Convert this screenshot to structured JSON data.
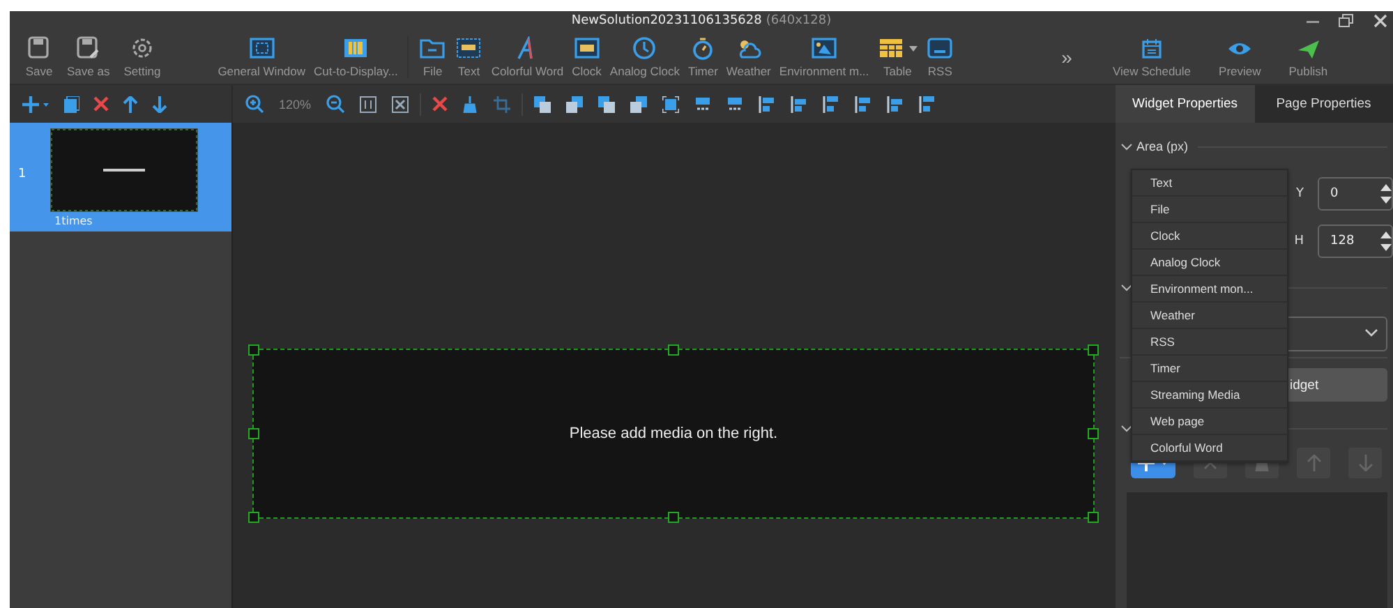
{
  "window": {
    "title": "NewSolution20231106135628",
    "resolution": "(640x128)"
  },
  "toolbar_groups": [
    {
      "items": [
        {
          "label": "Save",
          "has_menu": false
        },
        {
          "label": "Save as",
          "has_menu": false
        },
        {
          "label": "Setting",
          "has_menu": false
        }
      ]
    },
    {
      "items": [
        {
          "label": "General Window",
          "has_menu": false
        },
        {
          "label": "Cut-to-Display...",
          "has_menu": false
        }
      ]
    },
    {
      "items": [
        {
          "label": "File",
          "has_menu": false
        },
        {
          "label": "Text",
          "has_menu": false
        },
        {
          "label": "Colorful Word",
          "has_menu": false
        },
        {
          "label": "Clock",
          "has_menu": false
        },
        {
          "label": "Analog Clock",
          "has_menu": false
        },
        {
          "label": "Timer",
          "has_menu": false
        },
        {
          "label": "Weather",
          "has_menu": false
        },
        {
          "label": "Environment m...",
          "has_menu": false
        },
        {
          "label": "Table",
          "has_menu": true
        },
        {
          "label": "RSS",
          "has_menu": false
        }
      ]
    }
  ],
  "more": "»",
  "actions": [
    {
      "label": "View Schedule"
    },
    {
      "label": "Preview"
    },
    {
      "label": "Publish"
    }
  ],
  "zoom": "120%",
  "pages": [
    {
      "number": "1",
      "caption": "1times",
      "selected": true
    }
  ],
  "canvas": {
    "message": "Please add media on the right."
  },
  "properties": {
    "tabs": [
      {
        "label": "Widget Properties",
        "selected": true
      },
      {
        "label": "Page Properties",
        "selected": false
      }
    ],
    "area_section": "Area (px)",
    "fields": [
      {
        "label": "Y",
        "value": "0"
      },
      {
        "label": "H",
        "value": "128"
      }
    ],
    "widget_button": "idget"
  },
  "add_menu": {
    "items": [
      {
        "label": "Text"
      },
      {
        "label": "File"
      },
      {
        "label": "Clock"
      },
      {
        "label": "Analog Clock"
      },
      {
        "label": "Environment mon..."
      },
      {
        "label": "Weather"
      },
      {
        "label": "RSS"
      },
      {
        "label": "Timer"
      },
      {
        "label": "Streaming Media"
      },
      {
        "label": "Web page"
      },
      {
        "label": "Colorful Word"
      }
    ]
  }
}
